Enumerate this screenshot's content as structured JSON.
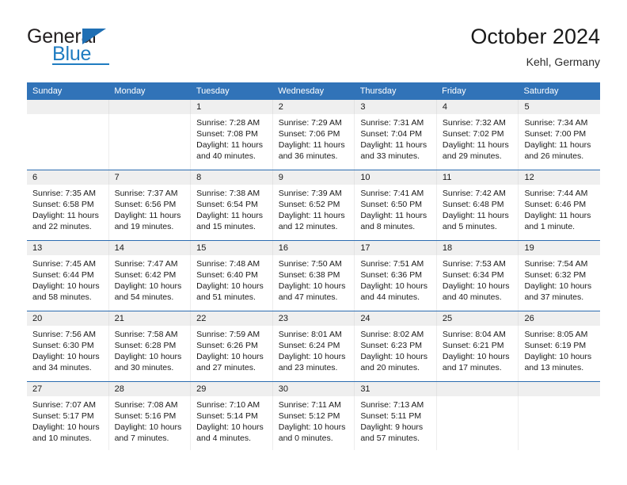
{
  "logo": {
    "word_one": "General",
    "word_two": "Blue",
    "triangle_icon": "triangle-icon"
  },
  "header": {
    "title": "October 2024",
    "subtitle": "Kehl, Germany"
  },
  "colors": {
    "header_blue": "#3173b8",
    "row_divider_blue": "#2c6cb0",
    "day_band_gray": "#efefef",
    "logo_blue": "#1f7cc1",
    "text": "#1a1a1a"
  },
  "weekdays": [
    "Sunday",
    "Monday",
    "Tuesday",
    "Wednesday",
    "Thursday",
    "Friday",
    "Saturday"
  ],
  "weeks": [
    {
      "days": [
        {
          "num": "",
          "sunrise": "",
          "sunset": "",
          "daylight_1": "",
          "daylight_2": "",
          "empty": true
        },
        {
          "num": "",
          "sunrise": "",
          "sunset": "",
          "daylight_1": "",
          "daylight_2": "",
          "empty": true
        },
        {
          "num": "1",
          "sunrise": "Sunrise: 7:28 AM",
          "sunset": "Sunset: 7:08 PM",
          "daylight_1": "Daylight: 11 hours",
          "daylight_2": "and 40 minutes."
        },
        {
          "num": "2",
          "sunrise": "Sunrise: 7:29 AM",
          "sunset": "Sunset: 7:06 PM",
          "daylight_1": "Daylight: 11 hours",
          "daylight_2": "and 36 minutes."
        },
        {
          "num": "3",
          "sunrise": "Sunrise: 7:31 AM",
          "sunset": "Sunset: 7:04 PM",
          "daylight_1": "Daylight: 11 hours",
          "daylight_2": "and 33 minutes."
        },
        {
          "num": "4",
          "sunrise": "Sunrise: 7:32 AM",
          "sunset": "Sunset: 7:02 PM",
          "daylight_1": "Daylight: 11 hours",
          "daylight_2": "and 29 minutes."
        },
        {
          "num": "5",
          "sunrise": "Sunrise: 7:34 AM",
          "sunset": "Sunset: 7:00 PM",
          "daylight_1": "Daylight: 11 hours",
          "daylight_2": "and 26 minutes."
        }
      ]
    },
    {
      "days": [
        {
          "num": "6",
          "sunrise": "Sunrise: 7:35 AM",
          "sunset": "Sunset: 6:58 PM",
          "daylight_1": "Daylight: 11 hours",
          "daylight_2": "and 22 minutes."
        },
        {
          "num": "7",
          "sunrise": "Sunrise: 7:37 AM",
          "sunset": "Sunset: 6:56 PM",
          "daylight_1": "Daylight: 11 hours",
          "daylight_2": "and 19 minutes."
        },
        {
          "num": "8",
          "sunrise": "Sunrise: 7:38 AM",
          "sunset": "Sunset: 6:54 PM",
          "daylight_1": "Daylight: 11 hours",
          "daylight_2": "and 15 minutes."
        },
        {
          "num": "9",
          "sunrise": "Sunrise: 7:39 AM",
          "sunset": "Sunset: 6:52 PM",
          "daylight_1": "Daylight: 11 hours",
          "daylight_2": "and 12 minutes."
        },
        {
          "num": "10",
          "sunrise": "Sunrise: 7:41 AM",
          "sunset": "Sunset: 6:50 PM",
          "daylight_1": "Daylight: 11 hours",
          "daylight_2": "and 8 minutes."
        },
        {
          "num": "11",
          "sunrise": "Sunrise: 7:42 AM",
          "sunset": "Sunset: 6:48 PM",
          "daylight_1": "Daylight: 11 hours",
          "daylight_2": "and 5 minutes."
        },
        {
          "num": "12",
          "sunrise": "Sunrise: 7:44 AM",
          "sunset": "Sunset: 6:46 PM",
          "daylight_1": "Daylight: 11 hours",
          "daylight_2": "and 1 minute."
        }
      ]
    },
    {
      "days": [
        {
          "num": "13",
          "sunrise": "Sunrise: 7:45 AM",
          "sunset": "Sunset: 6:44 PM",
          "daylight_1": "Daylight: 10 hours",
          "daylight_2": "and 58 minutes."
        },
        {
          "num": "14",
          "sunrise": "Sunrise: 7:47 AM",
          "sunset": "Sunset: 6:42 PM",
          "daylight_1": "Daylight: 10 hours",
          "daylight_2": "and 54 minutes."
        },
        {
          "num": "15",
          "sunrise": "Sunrise: 7:48 AM",
          "sunset": "Sunset: 6:40 PM",
          "daylight_1": "Daylight: 10 hours",
          "daylight_2": "and 51 minutes."
        },
        {
          "num": "16",
          "sunrise": "Sunrise: 7:50 AM",
          "sunset": "Sunset: 6:38 PM",
          "daylight_1": "Daylight: 10 hours",
          "daylight_2": "and 47 minutes."
        },
        {
          "num": "17",
          "sunrise": "Sunrise: 7:51 AM",
          "sunset": "Sunset: 6:36 PM",
          "daylight_1": "Daylight: 10 hours",
          "daylight_2": "and 44 minutes."
        },
        {
          "num": "18",
          "sunrise": "Sunrise: 7:53 AM",
          "sunset": "Sunset: 6:34 PM",
          "daylight_1": "Daylight: 10 hours",
          "daylight_2": "and 40 minutes."
        },
        {
          "num": "19",
          "sunrise": "Sunrise: 7:54 AM",
          "sunset": "Sunset: 6:32 PM",
          "daylight_1": "Daylight: 10 hours",
          "daylight_2": "and 37 minutes."
        }
      ]
    },
    {
      "days": [
        {
          "num": "20",
          "sunrise": "Sunrise: 7:56 AM",
          "sunset": "Sunset: 6:30 PM",
          "daylight_1": "Daylight: 10 hours",
          "daylight_2": "and 34 minutes."
        },
        {
          "num": "21",
          "sunrise": "Sunrise: 7:58 AM",
          "sunset": "Sunset: 6:28 PM",
          "daylight_1": "Daylight: 10 hours",
          "daylight_2": "and 30 minutes."
        },
        {
          "num": "22",
          "sunrise": "Sunrise: 7:59 AM",
          "sunset": "Sunset: 6:26 PM",
          "daylight_1": "Daylight: 10 hours",
          "daylight_2": "and 27 minutes."
        },
        {
          "num": "23",
          "sunrise": "Sunrise: 8:01 AM",
          "sunset": "Sunset: 6:24 PM",
          "daylight_1": "Daylight: 10 hours",
          "daylight_2": "and 23 minutes."
        },
        {
          "num": "24",
          "sunrise": "Sunrise: 8:02 AM",
          "sunset": "Sunset: 6:23 PM",
          "daylight_1": "Daylight: 10 hours",
          "daylight_2": "and 20 minutes."
        },
        {
          "num": "25",
          "sunrise": "Sunrise: 8:04 AM",
          "sunset": "Sunset: 6:21 PM",
          "daylight_1": "Daylight: 10 hours",
          "daylight_2": "and 17 minutes."
        },
        {
          "num": "26",
          "sunrise": "Sunrise: 8:05 AM",
          "sunset": "Sunset: 6:19 PM",
          "daylight_1": "Daylight: 10 hours",
          "daylight_2": "and 13 minutes."
        }
      ]
    },
    {
      "days": [
        {
          "num": "27",
          "sunrise": "Sunrise: 7:07 AM",
          "sunset": "Sunset: 5:17 PM",
          "daylight_1": "Daylight: 10 hours",
          "daylight_2": "and 10 minutes."
        },
        {
          "num": "28",
          "sunrise": "Sunrise: 7:08 AM",
          "sunset": "Sunset: 5:16 PM",
          "daylight_1": "Daylight: 10 hours",
          "daylight_2": "and 7 minutes."
        },
        {
          "num": "29",
          "sunrise": "Sunrise: 7:10 AM",
          "sunset": "Sunset: 5:14 PM",
          "daylight_1": "Daylight: 10 hours",
          "daylight_2": "and 4 minutes."
        },
        {
          "num": "30",
          "sunrise": "Sunrise: 7:11 AM",
          "sunset": "Sunset: 5:12 PM",
          "daylight_1": "Daylight: 10 hours",
          "daylight_2": "and 0 minutes."
        },
        {
          "num": "31",
          "sunrise": "Sunrise: 7:13 AM",
          "sunset": "Sunset: 5:11 PM",
          "daylight_1": "Daylight: 9 hours",
          "daylight_2": "and 57 minutes."
        },
        {
          "num": "",
          "sunrise": "",
          "sunset": "",
          "daylight_1": "",
          "daylight_2": "",
          "empty": true
        },
        {
          "num": "",
          "sunrise": "",
          "sunset": "",
          "daylight_1": "",
          "daylight_2": "",
          "empty": true
        }
      ]
    }
  ]
}
